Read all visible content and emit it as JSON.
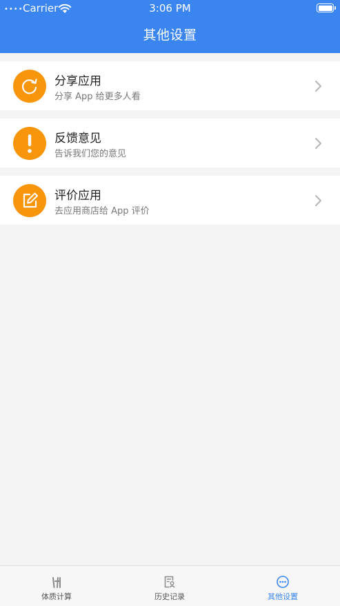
{
  "status_bar": {
    "carrier": "Carrier",
    "time": "3:06 PM",
    "signal": "••••"
  },
  "header": {
    "title": "其他设置",
    "color": "#3a85ef"
  },
  "rows": [
    {
      "title": "分享应用",
      "subtitle": "分享 App 给更多人看",
      "icon": "share-icon",
      "icon_color": "#f7950b"
    },
    {
      "title": "反馈意见",
      "subtitle": "告诉我们您的意见",
      "icon": "exclamation-icon",
      "icon_color": "#f7950b"
    },
    {
      "title": "评价应用",
      "subtitle": "去应用商店给 App 评价",
      "icon": "edit-icon",
      "icon_color": "#f7950b"
    }
  ],
  "tabbar": {
    "tabs": [
      {
        "label": "体质计算",
        "icon": "scale-icon",
        "active": false
      },
      {
        "label": "历史记录",
        "icon": "history-icon",
        "active": false
      },
      {
        "label": "其他设置",
        "icon": "more-icon",
        "active": true
      }
    ],
    "active_color": "#3a85ef"
  }
}
